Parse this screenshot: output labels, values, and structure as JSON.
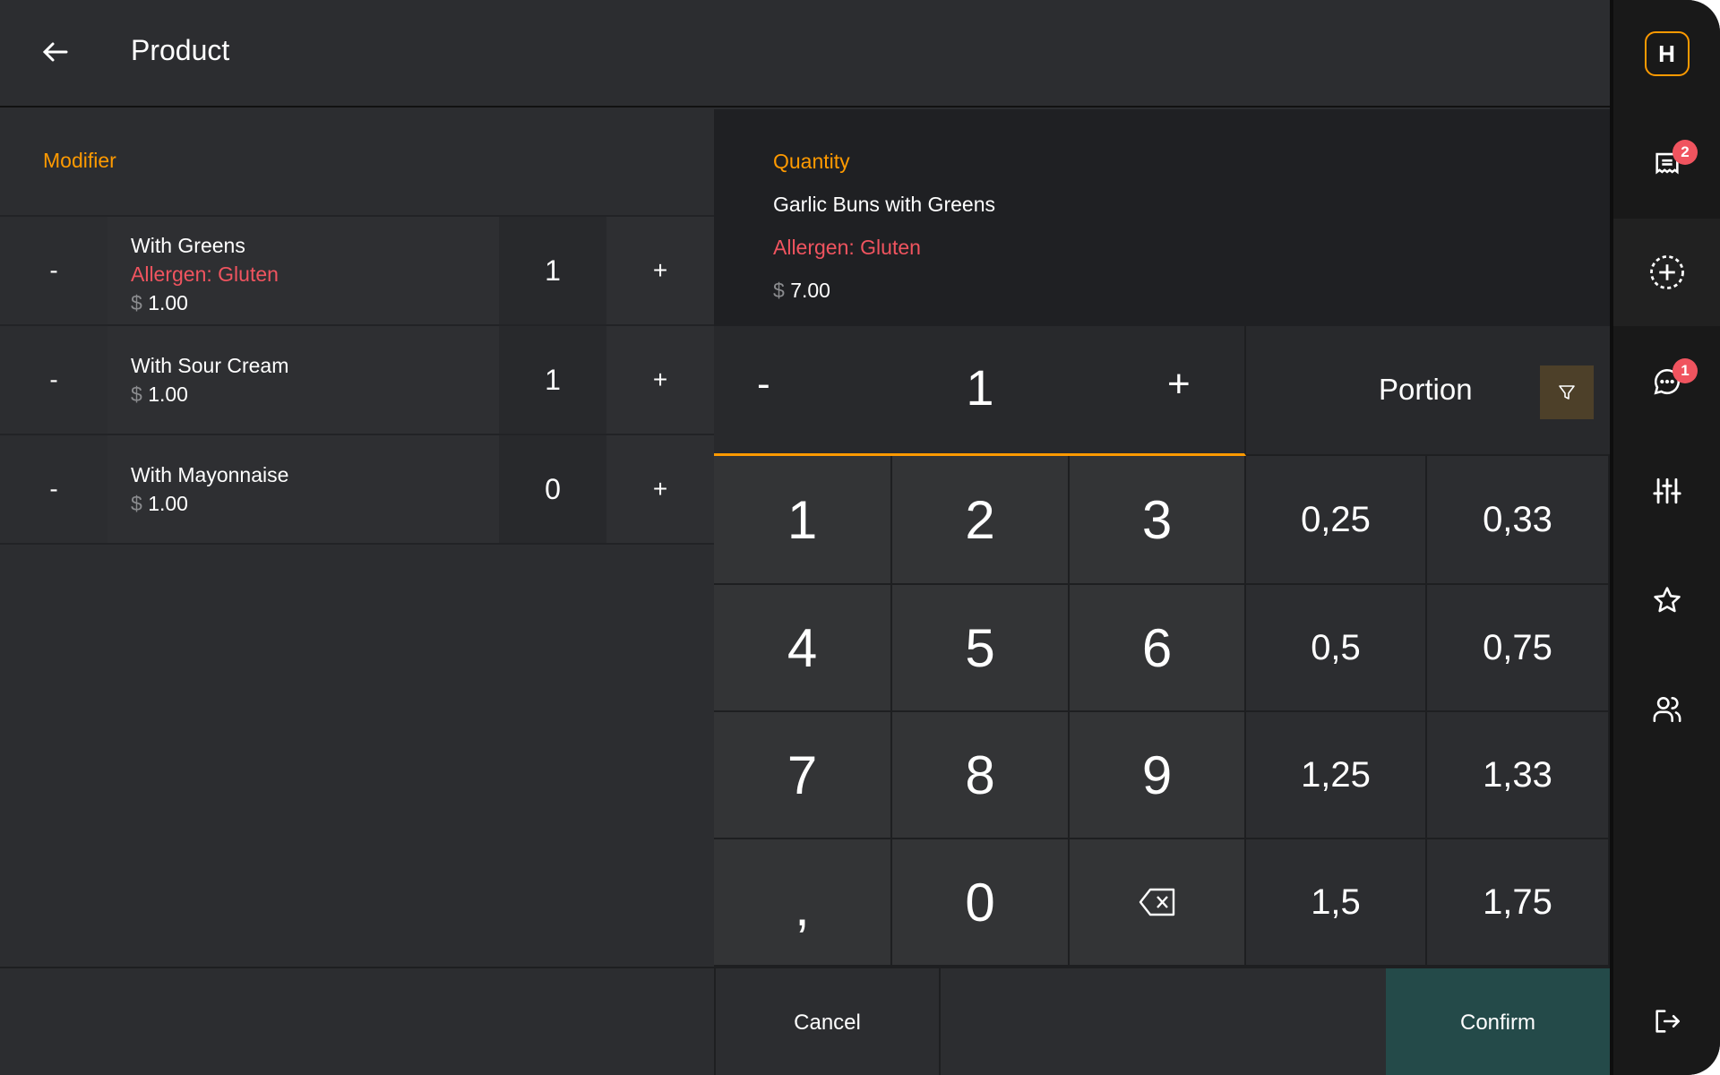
{
  "header": {
    "title": "Product"
  },
  "modifiers": {
    "title": "Modifier",
    "items": [
      {
        "name": "With Greens",
        "allergen": "Allergen: Gluten",
        "currency": "$",
        "price": "1.00",
        "qty": "1"
      },
      {
        "name": "With Sour Cream",
        "currency": "$",
        "price": "1.00",
        "qty": "1"
      },
      {
        "name": "With Mayonnaise",
        "currency": "$",
        "price": "1.00",
        "qty": "0"
      }
    ],
    "minus": "-",
    "plus": "+"
  },
  "product": {
    "section": "Quantity",
    "name": "Garlic Buns with Greens",
    "allergen": "Allergen: Gluten",
    "currency": "$",
    "price": "7.00"
  },
  "stepper": {
    "minus": "-",
    "value": "1",
    "plus": "+"
  },
  "portion": {
    "label": "Portion"
  },
  "keypad": {
    "digits": [
      "1",
      "2",
      "3",
      "4",
      "5",
      "6",
      "7",
      "8",
      "9",
      ",",
      "0"
    ],
    "fractions": [
      "0,25",
      "0,33",
      "0,5",
      "0,75",
      "1,25",
      "1,33",
      "1,5",
      "1,75"
    ]
  },
  "footer": {
    "cancel": "Cancel",
    "confirm": "Confirm"
  },
  "sidebar": {
    "logo": "H",
    "orders_badge": "2",
    "messages_badge": "1"
  },
  "colors": {
    "accent": "#ff9a00",
    "allergen": "#f0545f",
    "confirm": "#244a49",
    "filter": "#4d4029"
  }
}
